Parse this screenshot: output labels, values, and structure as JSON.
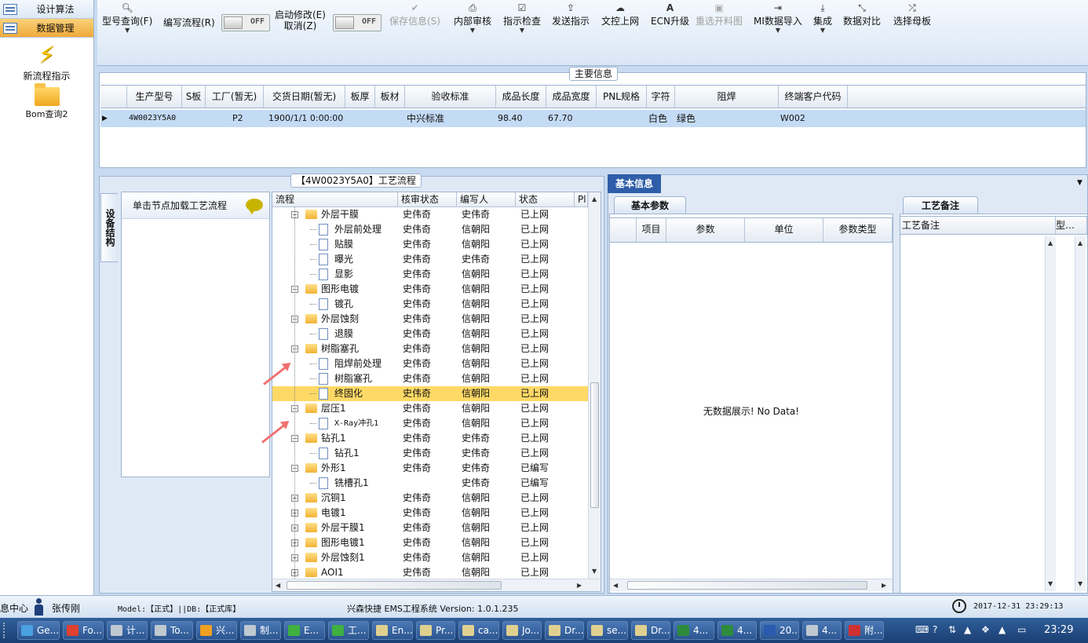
{
  "sidebar": {
    "items": [
      {
        "label": "设计算法"
      },
      {
        "label": "数据管理"
      }
    ],
    "shortcuts": [
      {
        "label": "新流程指示"
      },
      {
        "label": "Bom查询2"
      }
    ]
  },
  "toolbar": {
    "model_query": "型号查询(F)",
    "edit_flow": "编写流程(R)",
    "toggle1": "OFF",
    "start_edit": "启动修改(E)",
    "cancel": "取消(Z)",
    "toggle2": "OFF",
    "save": "保存信息(S)",
    "internal_review": "内部审核",
    "check": "指示检查",
    "send": "发送指示",
    "upload": "文控上网",
    "ecn": "ECN升级",
    "reselect": "重选开料图",
    "mi_import": "MI数据导入",
    "integrate": "集成",
    "compare": "数据对比",
    "select_mother": "选择母板"
  },
  "main_info": {
    "title": "主要信息",
    "columns": [
      "生产型号",
      "S板",
      "工厂(暂无)",
      "交货日期(暂无)",
      "板厚",
      "板材",
      "验收标准",
      "成品长度",
      "成品宽度",
      "PNL规格",
      "字符",
      "阻焊",
      "终端客户代码"
    ],
    "row": [
      "4W0023Y5A0",
      "",
      "P2",
      "1900/1/1 0:00:00",
      "",
      "",
      "中兴标准",
      "98.40",
      "67.70",
      "",
      "白色",
      "绿色",
      "W002"
    ]
  },
  "process": {
    "title": "【4W0023Y5A0】工艺流程",
    "vertical_tab": "设备结构",
    "load_hint": "单击节点加载工艺流程",
    "columns": [
      "流程",
      "核审状态",
      "编写人",
      "状态",
      "Pl"
    ],
    "rows": [
      {
        "name": "外层干膜",
        "type": "folder",
        "level": 1,
        "expander": "−",
        "review": "史伟奇",
        "writer": "史伟奇",
        "status": "已上网"
      },
      {
        "name": "外层前处理",
        "type": "doc",
        "level": 2,
        "review": "史伟奇",
        "writer": "信朝阳",
        "status": "已上网"
      },
      {
        "name": "贴膜",
        "type": "doc",
        "level": 2,
        "review": "史伟奇",
        "writer": "信朝阳",
        "status": "已上网"
      },
      {
        "name": "曝光",
        "type": "doc",
        "level": 2,
        "review": "史伟奇",
        "writer": "史伟奇",
        "status": "已上网"
      },
      {
        "name": "显影",
        "type": "doc",
        "level": 2,
        "review": "史伟奇",
        "writer": "信朝阳",
        "status": "已上网"
      },
      {
        "name": "图形电镀",
        "type": "folder",
        "level": 1,
        "expander": "−",
        "review": "史伟奇",
        "writer": "信朝阳",
        "status": "已上网"
      },
      {
        "name": "镀孔",
        "type": "doc",
        "level": 2,
        "review": "史伟奇",
        "writer": "信朝阳",
        "status": "已上网"
      },
      {
        "name": "外层蚀刻",
        "type": "folder",
        "level": 1,
        "expander": "−",
        "review": "史伟奇",
        "writer": "信朝阳",
        "status": "已上网"
      },
      {
        "name": "退膜",
        "type": "doc",
        "level": 2,
        "review": "史伟奇",
        "writer": "信朝阳",
        "status": "已上网"
      },
      {
        "name": "树脂塞孔",
        "type": "folder",
        "level": 1,
        "expander": "−",
        "review": "史伟奇",
        "writer": "信朝阳",
        "status": "已上网"
      },
      {
        "name": "阻焊前处理",
        "type": "doc",
        "level": 2,
        "review": "史伟奇",
        "writer": "信朝阳",
        "status": "已上网"
      },
      {
        "name": "树脂塞孔",
        "type": "doc",
        "level": 2,
        "review": "史伟奇",
        "writer": "信朝阳",
        "status": "已上网"
      },
      {
        "name": "终固化",
        "type": "doc",
        "level": 2,
        "review": "史伟奇",
        "writer": "信朝阳",
        "status": "已上网",
        "selected": true
      },
      {
        "name": "层压1",
        "type": "folder",
        "level": 1,
        "expander": "−",
        "review": "史伟奇",
        "writer": "信朝阳",
        "status": "已上网"
      },
      {
        "name": "X-Ray冲孔1",
        "type": "doc",
        "level": 2,
        "review": "史伟奇",
        "writer": "信朝阳",
        "status": "已上网"
      },
      {
        "name": "钻孔1",
        "type": "folder",
        "level": 1,
        "expander": "−",
        "review": "史伟奇",
        "writer": "史伟奇",
        "status": "已上网"
      },
      {
        "name": "钻孔1",
        "type": "doc",
        "level": 2,
        "review": "史伟奇",
        "writer": "史伟奇",
        "status": "已上网"
      },
      {
        "name": "外形1",
        "type": "folder",
        "level": 1,
        "expander": "−",
        "review": "史伟奇",
        "writer": "史伟奇",
        "status": "已编写"
      },
      {
        "name": "铣槽孔1",
        "type": "doc",
        "level": 2,
        "review": "",
        "writer": "史伟奇",
        "status": "已编写"
      },
      {
        "name": "沉铜1",
        "type": "folder",
        "level": 1,
        "expander": "+",
        "review": "史伟奇",
        "writer": "信朝阳",
        "status": "已上网"
      },
      {
        "name": "电镀1",
        "type": "folder",
        "level": 1,
        "expander": "+",
        "review": "史伟奇",
        "writer": "信朝阳",
        "status": "已上网"
      },
      {
        "name": "外层干膜1",
        "type": "folder",
        "level": 1,
        "expander": "+",
        "review": "史伟奇",
        "writer": "信朝阳",
        "status": "已上网"
      },
      {
        "name": "图形电镀1",
        "type": "folder",
        "level": 1,
        "expander": "+",
        "review": "史伟奇",
        "writer": "信朝阳",
        "status": "已上网"
      },
      {
        "name": "外层蚀刻1",
        "type": "folder",
        "level": 1,
        "expander": "+",
        "review": "史伟奇",
        "writer": "信朝阳",
        "status": "已上网"
      },
      {
        "name": "AOI1",
        "type": "folder",
        "level": 1,
        "expander": "+",
        "review": "史伟奇",
        "writer": "信朝阳",
        "status": "已上网"
      }
    ]
  },
  "basic_info": {
    "title": "基本信息",
    "tab_params": "基本参数",
    "tab_notes": "工艺备注",
    "param_columns": [
      "项目",
      "参数",
      "单位",
      "参数类型"
    ],
    "no_data": "无数据展示! No Data!",
    "notes_columns": [
      "工艺备注",
      "型…"
    ]
  },
  "status": {
    "left": "息中心",
    "user": "张传刚",
    "model": "Model:【正式】||DB:【正式库】",
    "system": "兴森快捷 EMS工程系统 Version: 1.0.1.235",
    "datetime": "2017-12-31 23:29:13"
  },
  "taskbar": {
    "items": [
      {
        "label": "Ge...",
        "color": "#4aa0e0"
      },
      {
        "label": "Fo...",
        "color": "#e04030"
      },
      {
        "label": "计...",
        "color": "#c0c8d0"
      },
      {
        "label": "To...",
        "color": "#c0c8d0"
      },
      {
        "label": "兴...",
        "color": "#f0a020"
      },
      {
        "label": "制...",
        "color": "#c0c8d0"
      },
      {
        "label": "E...",
        "color": "#40b040"
      },
      {
        "label": "工...",
        "color": "#40b040"
      },
      {
        "label": "En...",
        "color": "#e0d090"
      },
      {
        "label": "Pr...",
        "color": "#e0d090"
      },
      {
        "label": "ca...",
        "color": "#e0d090"
      },
      {
        "label": "Jo...",
        "color": "#e0d090"
      },
      {
        "label": "Dr...",
        "color": "#e0d090"
      },
      {
        "label": "se...",
        "color": "#e0d090"
      },
      {
        "label": "Dr...",
        "color": "#e0d090"
      },
      {
        "label": "4...",
        "color": "#2e8b3e"
      },
      {
        "label": "4...",
        "color": "#2e8b3e"
      },
      {
        "label": "20...",
        "color": "#2a5bb0"
      },
      {
        "label": "4...",
        "color": "#c0c8d0"
      },
      {
        "label": "附...",
        "color": "#d03030"
      }
    ],
    "time": "23:29"
  }
}
